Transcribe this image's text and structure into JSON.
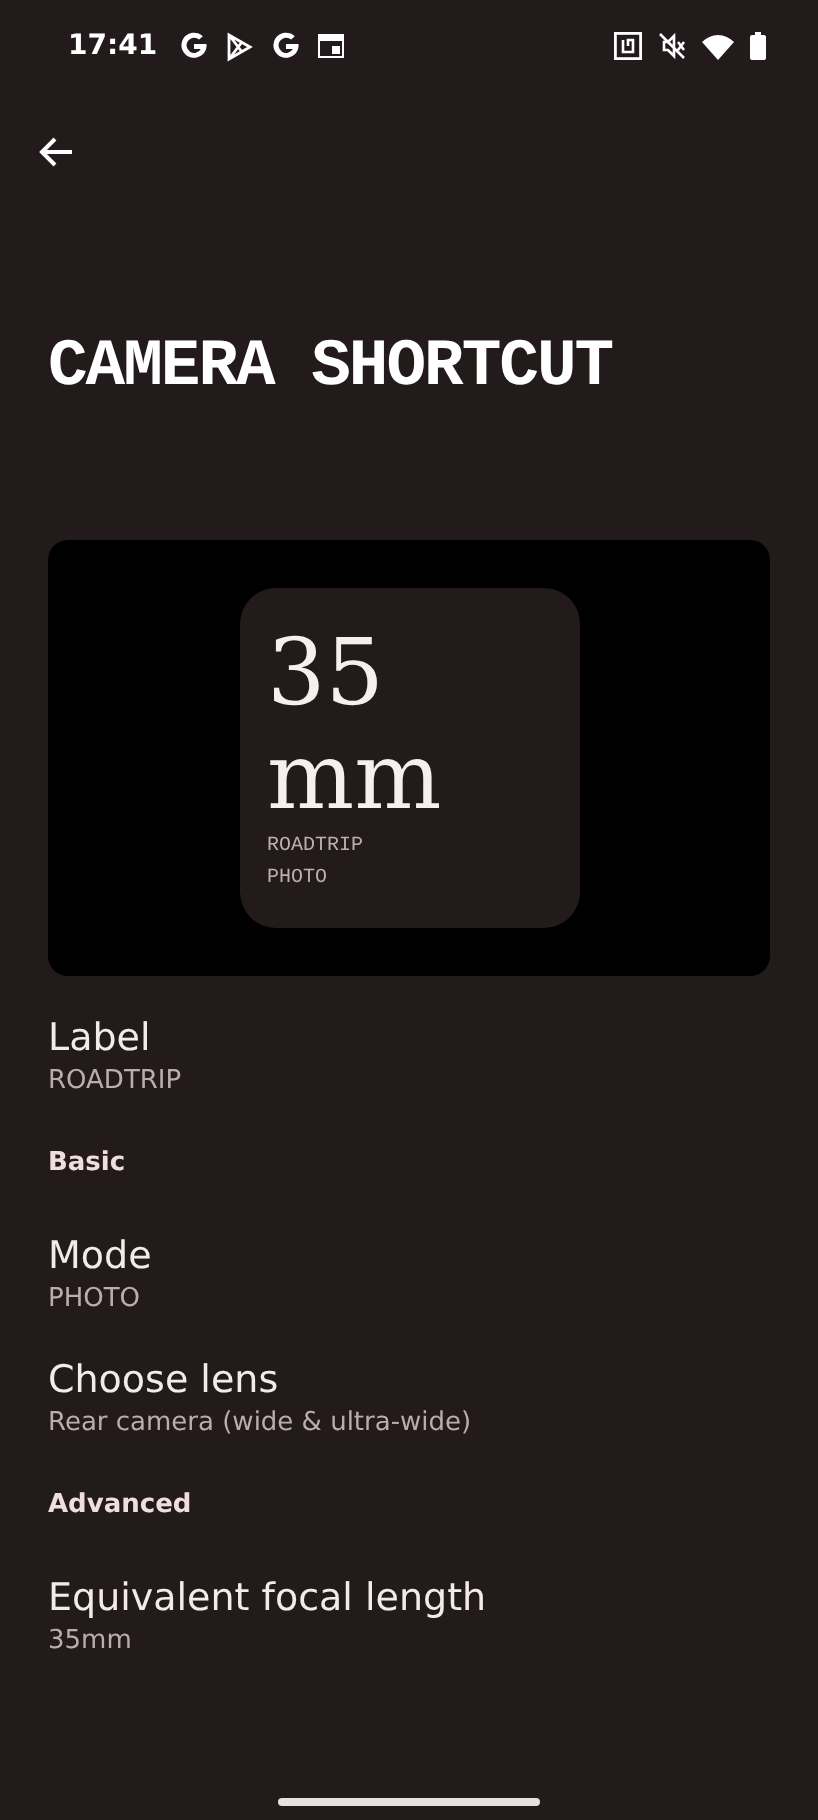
{
  "status_bar": {
    "time": "17:41"
  },
  "title": "CAMERA SHORTCUT",
  "preview": {
    "value": "35",
    "unit": "mm",
    "lines": [
      "ROADTRIP",
      "PHOTO"
    ]
  },
  "rows": [
    {
      "kind": "item",
      "title": "Label",
      "subtitle": "ROADTRIP"
    },
    {
      "kind": "header",
      "title": "Basic"
    },
    {
      "kind": "item",
      "title": "Mode",
      "subtitle": "PHOTO"
    },
    {
      "kind": "item",
      "title": "Choose lens",
      "subtitle": "Rear camera (wide & ultra-wide)"
    },
    {
      "kind": "header",
      "title": "Advanced"
    },
    {
      "kind": "item",
      "title": "Equivalent focal length",
      "subtitle": "35mm"
    }
  ]
}
